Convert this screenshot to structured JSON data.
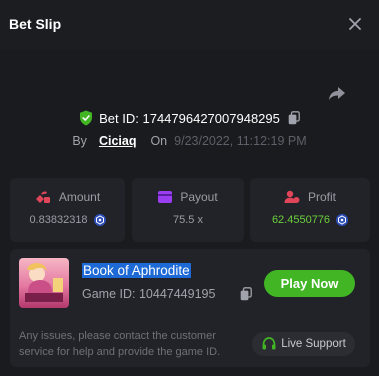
{
  "header": {
    "title": "Bet Slip",
    "close_icon": "close-icon"
  },
  "bet": {
    "id": "Bet ID: 1744796427007948295",
    "by_label": "By",
    "user": "Ciciaq",
    "on_label": "On",
    "date": "9/23/2022, 11:12:19 PM"
  },
  "stats": [
    {
      "label": "Amount",
      "value": "0.83832318",
      "icon": "amount-icon",
      "color": "#e0455a"
    },
    {
      "label": "Payout",
      "value": "75.5 x",
      "icon": "payout-icon",
      "color": "#9b3df0"
    },
    {
      "label": "Profit",
      "value": "62.4550776",
      "icon": "profit-icon",
      "color": "#e0455a"
    }
  ],
  "game": {
    "name": "Book of Aphrodite",
    "id": "Game ID: 10447449195",
    "play_label": "Play Now",
    "notice": "Any issues, please contact the customer service for help and provide the game ID.",
    "support_label": "Live Support"
  },
  "colors": {
    "accent_green": "#41b524",
    "profit_green": "#6bd03b",
    "highlight_blue": "#1d6ad6"
  }
}
